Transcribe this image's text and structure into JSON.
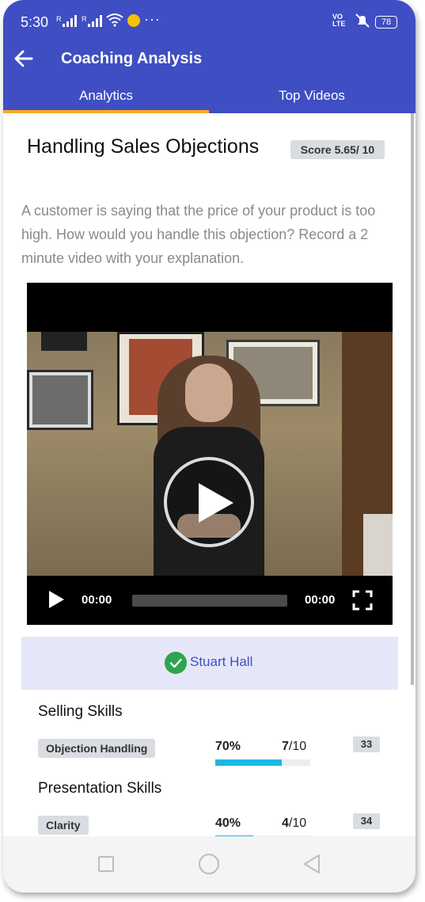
{
  "status_bar": {
    "time": "5:30",
    "signal1_label": "R",
    "signal2_label": "R",
    "notification_more": "···",
    "network_label": "VO LTE",
    "battery": "78",
    "icons": [
      "wifi-icon",
      "bulb-icon",
      "mute-icon",
      "battery-icon"
    ]
  },
  "appbar": {
    "title": "Coaching Analysis",
    "back_icon": "arrow-left-icon"
  },
  "tabs": [
    {
      "label": "Analytics",
      "active": true
    },
    {
      "label": "Top Videos",
      "active": false
    }
  ],
  "question": {
    "title": "Handling Sales Objections",
    "score": "Score 5.65/ 10",
    "description": "A customer is saying that the price of your product is too high. How would you handle this objection? Record a 2 minute video with your explanation."
  },
  "video": {
    "current_time": "00:00",
    "duration": "00:00",
    "progress": 0
  },
  "user": {
    "name": "Stuart Hall",
    "verified_icon": "check-circle-icon"
  },
  "skill_groups": [
    {
      "title": "Selling Skills",
      "skill": "Objection Handling",
      "percent": "70%",
      "score": "7",
      "out_of": "/10",
      "fill": 0.7,
      "count": "33"
    },
    {
      "title": "Presentation Skills",
      "skill": "Clarity",
      "percent": "40%",
      "score": "4",
      "out_of": "/10",
      "fill": 0.4,
      "count": "34"
    }
  ],
  "colors": {
    "primary": "#3F4EC3",
    "tab_indicator": "#F9A825",
    "progress": "#1BB8E0",
    "chip_bg": "#D9DCE1",
    "user_bar_bg": "#E5E7F8",
    "verified": "#2DA44E"
  }
}
